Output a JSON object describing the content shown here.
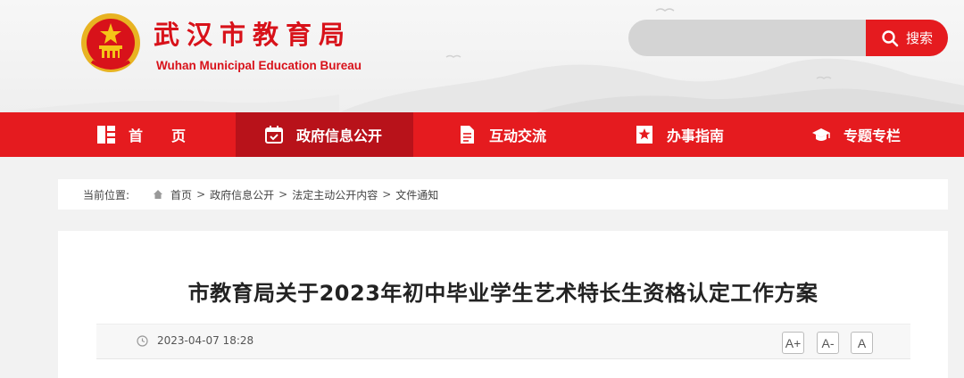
{
  "header": {
    "title": "武汉市教育局",
    "subtitle": "Wuhan Municipal Education Bureau",
    "logo_icon": "national-emblem-icon"
  },
  "search": {
    "placeholder": "",
    "button_label": "搜索",
    "button_icon": "search-icon"
  },
  "nav": {
    "items": [
      {
        "label": "首　　页",
        "icon": "home-grid-icon",
        "active": false
      },
      {
        "label": "政府信息公开",
        "icon": "calendar-check-icon",
        "active": true
      },
      {
        "label": "互动交流",
        "icon": "document-icon",
        "active": false
      },
      {
        "label": "办事指南",
        "icon": "bookmark-star-icon",
        "active": false
      },
      {
        "label": "专题专栏",
        "icon": "graduation-cap-icon",
        "active": false
      }
    ]
  },
  "breadcrumb": {
    "label": "当前位置:",
    "items": [
      "首页",
      "政府信息公开",
      "法定主动公开内容",
      "文件通知"
    ],
    "separator": ">"
  },
  "article": {
    "title": "市教育局关于2023年初中毕业学生艺术特长生资格认定工作方案",
    "date": "2023-04-07 18:28",
    "font_buttons": [
      "A+",
      "A-",
      "A"
    ]
  },
  "colors": {
    "brand_red": "#e51b1f",
    "nav_active": "#b8121a",
    "title_red": "#d8121a"
  }
}
